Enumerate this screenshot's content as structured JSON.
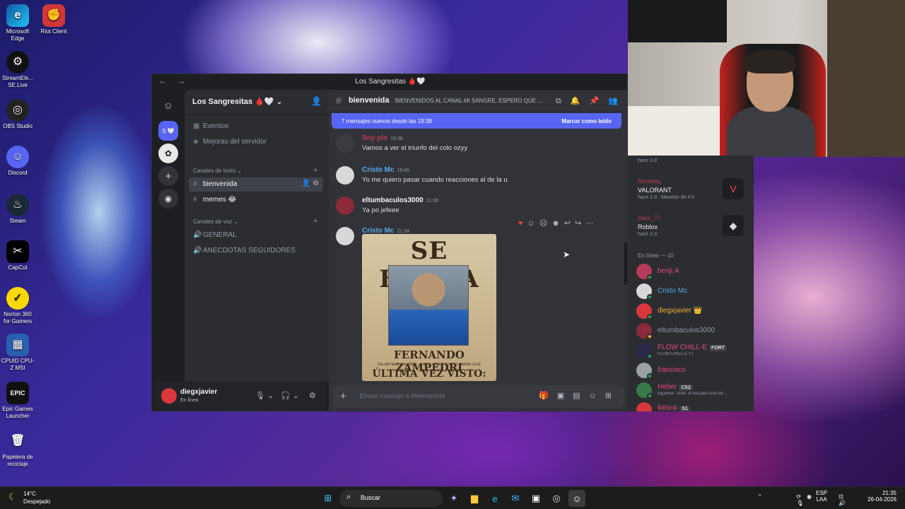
{
  "desktop": {
    "icons": [
      "Microsoft Edge",
      "Riot Client",
      "StreamEle... SE.Live",
      "OBS Studio",
      "Discord",
      "Steam",
      "CapCut",
      "Norton 360 for Gamers",
      "CPUID CPU-Z MSI",
      "Epic Games Launcher",
      "Papelera de reciclaje"
    ]
  },
  "window": {
    "title": "Los Sangresitas 🩸🤍"
  },
  "server": {
    "name": "Los Sangresitas 🩸🤍",
    "top_items": [
      "Eventos",
      "Mejoras del servidor"
    ],
    "text_category": "Canales de texto",
    "text_channels": [
      "bienvenida",
      "memes 😂"
    ],
    "voice_category": "Canales de voz",
    "voice_channels": [
      "GENERAL",
      "ANECDOTAS SEGUIDORES"
    ]
  },
  "user": {
    "name": "diegxjavier",
    "status": "En línea"
  },
  "chat": {
    "channel": "bienvenida",
    "topic": "BIENVENIDOS AL CANAL MI SANGRE, ESPERO QUE ...",
    "new_messages": "7 mensajes nuevos desde las 19:38",
    "mark_read": "Marcar como leído",
    "input_placeholder": "Enviar mensaje a #bienvenida",
    "messages": [
      {
        "author": "Soy plo",
        "time": "19:38",
        "text": "Vamos a ver el triunfo del colo ozyy",
        "color": "#c03a5a"
      },
      {
        "author": "Cristo Mc",
        "time": "19:45",
        "text": "Yo me quiero pasar cuando reacciones al de la u",
        "color": "#5aa7e8"
      },
      {
        "author": "eltumbaculos3000",
        "time": "21:06",
        "text": "Ya po jefeee",
        "color": "#f2f3f5"
      },
      {
        "author": "Cristo Mc",
        "time": "21:34",
        "text": "",
        "color": "#5aa7e8"
      }
    ],
    "poster": {
      "title": "SE BUSCA",
      "name": "FERNANDO ZAMPEDRI",
      "details": "DELANTERO · 36 AÑOS · 1.83 M · PELO CORTO, BARBA LEVE",
      "footer": "ÚLTIMA VEZ VISTO:"
    }
  },
  "activity": [
    {
      "user": "",
      "game": "",
      "when": "hace 3 d"
    },
    {
      "user": "Monkitag",
      "game": "VALORANT",
      "when": "hace 2 d",
      "extra": "Maratón de 4 h"
    },
    {
      "user": "claus_77",
      "game": "Roblox",
      "when": "hace 2 d"
    }
  ],
  "online_header": "En línea — 10",
  "members": [
    {
      "name": "benji.A",
      "color": "#e8477a",
      "sub": "",
      "tag": ""
    },
    {
      "name": "Cristo Mc",
      "color": "#5aa7e8",
      "sub": "",
      "tag": ""
    },
    {
      "name": "diegxjavier",
      "color": "#f0b232",
      "sub": "",
      "tag": "👑"
    },
    {
      "name": "eltumbaculos3000",
      "color": "#949ba4",
      "sub": "",
      "tag": ""
    },
    {
      "name": "FLOW CHILL-E",
      "color": "#e8477a",
      "sub": "FLOW CHILL-E YT",
      "tag": "FORT"
    },
    {
      "name": "francisco",
      "color": "#e8477a",
      "sub": "",
      "tag": ""
    },
    {
      "name": "Heber",
      "color": "#e8477a",
      "sub": "díganme \"rana\" al md para una sor...",
      "tag": "CS2"
    },
    {
      "name": "lkthink",
      "color": "#e8477a",
      "sub": "",
      "tag": "S1"
    }
  ],
  "taskbar": {
    "temp": "14°C",
    "weather": "Despejado",
    "search": "Buscar",
    "lang": "ESP",
    "lang2": "LAA",
    "time": "21:35",
    "date": "26-04-2026"
  }
}
